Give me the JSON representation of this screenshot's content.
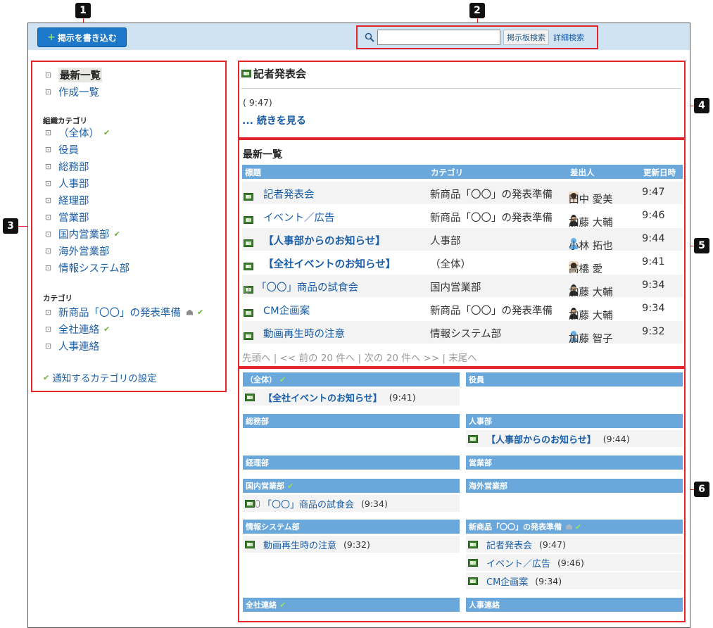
{
  "toolbar": {
    "post_button_label": "掲示を書き込む",
    "search_button_label": "掲示板検索",
    "advanced_search_label": "詳細検索",
    "search_value": ""
  },
  "markers": [
    "1",
    "2",
    "3",
    "4",
    "5",
    "6"
  ],
  "sidebar": {
    "top_items": [
      {
        "label": "最新一覧",
        "selected": true
      },
      {
        "label": "作成一覧"
      }
    ],
    "org_heading": "組織カテゴリ",
    "org_items": [
      {
        "label": "（全体）",
        "check": true
      },
      {
        "label": "役員"
      },
      {
        "label": "総務部"
      },
      {
        "label": "人事部"
      },
      {
        "label": "経理部"
      },
      {
        "label": "営業部"
      },
      {
        "label": "国内営業部",
        "check": true
      },
      {
        "label": "海外営業部"
      },
      {
        "label": "情報システム部"
      }
    ],
    "cat_heading": "カテゴリ",
    "cat_items": [
      {
        "label": "新商品「〇〇」の発表準備",
        "house": true,
        "check": true
      },
      {
        "label": "全社連絡",
        "check": true
      },
      {
        "label": "人事連絡"
      }
    ],
    "notify_label": "通知するカテゴリの設定"
  },
  "news": {
    "title": "記者発表会",
    "time": "( 9:47)",
    "more_label": "... 続きを見る"
  },
  "latest": {
    "title": "最新一覧",
    "columns": [
      "標題",
      "カテゴリ",
      "差出人",
      "更新日時"
    ],
    "rows": [
      {
        "title": "記者発表会",
        "category": "新商品「〇〇」の発表準備",
        "sender": "田中 愛美",
        "avatar": "photo",
        "time": "9:47"
      },
      {
        "title": "イベント／広告",
        "category": "新商品「〇〇」の発表準備",
        "sender": "加藤 大輔",
        "avatar": "suit",
        "time": "9:46"
      },
      {
        "title": "【人事部からのお知らせ】",
        "bold": true,
        "category": "人事部",
        "sender": "小林 拓也",
        "avatar": "generic",
        "time": "9:44"
      },
      {
        "title": "【全社イベントのお知らせ】",
        "bold": true,
        "category": "（全体）",
        "sender": "高橋 愛",
        "avatar": "photo",
        "time": "9:41"
      },
      {
        "title": "「〇〇」商品の試食会",
        "attach": true,
        "category": "国内営業部",
        "sender": "加藤 大輔",
        "avatar": "suit",
        "time": "9:34"
      },
      {
        "title": "CM企画案",
        "category": "新商品「〇〇」の発表準備",
        "sender": "加藤 大輔",
        "avatar": "suit",
        "time": "9:34"
      },
      {
        "title": "動画再生時の注意",
        "category": "情報システム部",
        "sender": "加藤 智子",
        "avatar": "generic",
        "time": "9:32"
      }
    ],
    "pager": "先頭へ | << 前の 20 件へ | 次の 20 件へ >> | 末尾へ"
  },
  "categories": [
    {
      "name": "（全体）",
      "check": true,
      "items": [
        {
          "title": "【全社イベントのお知らせ】",
          "bold": true,
          "time": "(9:41)"
        }
      ]
    },
    {
      "name": "役員",
      "items": []
    },
    {
      "name": "総務部",
      "items": []
    },
    {
      "name": "人事部",
      "items": [
        {
          "title": "【人事部からのお知らせ】",
          "bold": true,
          "time": "(9:44)"
        }
      ]
    },
    {
      "name": "経理部",
      "items": []
    },
    {
      "name": "営業部",
      "items": []
    },
    {
      "name": "国内営業部",
      "check": true,
      "items": [
        {
          "title": "「〇〇」商品の試食会",
          "attach": true,
          "time": "(9:34)"
        }
      ]
    },
    {
      "name": "海外営業部",
      "items": []
    },
    {
      "name": "情報システム部",
      "items": [
        {
          "title": "動画再生時の注意",
          "time": "(9:32)"
        }
      ]
    },
    {
      "name": "新商品「〇〇」の発表準備",
      "house": true,
      "check": true,
      "items": [
        {
          "title": "記者発表会",
          "time": "(9:47)"
        },
        {
          "title": "イベント／広告",
          "time": "(9:46)"
        },
        {
          "title": "CM企画案",
          "time": "(9:34)"
        }
      ]
    },
    {
      "name": "全社連絡",
      "check": true,
      "items": []
    },
    {
      "name": "人事連絡",
      "items": []
    }
  ]
}
